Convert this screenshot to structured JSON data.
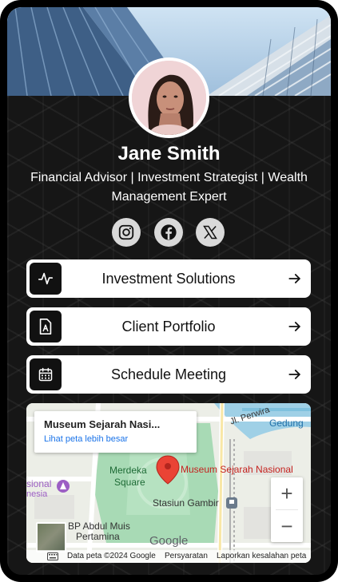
{
  "profile": {
    "name": "Jane Smith",
    "subtitle": "Financial Advisor | Investment Strategist | Wealth Management Expert"
  },
  "socials": [
    {
      "icon": "instagram-icon"
    },
    {
      "icon": "facebook-icon"
    },
    {
      "icon": "x-twitter-icon"
    }
  ],
  "links": [
    {
      "label": "Investment Solutions",
      "icon": "activity-pulse-icon"
    },
    {
      "label": "Client Portfolio",
      "icon": "document-a-icon"
    },
    {
      "label": "Schedule Meeting",
      "icon": "calendar-icon"
    }
  ],
  "map": {
    "place_title": "Museum Sejarah Nasi...",
    "view_larger": "Lihat peta lebih besar",
    "labels": {
      "street": "Jl. Perwira",
      "gedung": "Gedung",
      "merdeka_1": "Merdeka",
      "merdeka_2": "Square",
      "museum": "Museum Sejarah Nasional",
      "stasiun": "Stasiun Gambir",
      "nasional_1": "sional",
      "nasional_2": "nesia",
      "abdul_1": "BP Abdul Muis",
      "abdul_2": "Pertamina"
    },
    "zoom_in": "+",
    "zoom_out": "−",
    "google": "Google",
    "attribution": {
      "data": "Data peta ©2024 Google",
      "terms": "Persyaratan",
      "report": "Laporkan kesalahan peta"
    }
  },
  "colors": {
    "background": "#161616",
    "button_bg": "#ffffff",
    "icon_box": "#111111",
    "map_pin": "#ea4335",
    "map_park": "#a8dab5",
    "map_link": "#1a73e8"
  }
}
